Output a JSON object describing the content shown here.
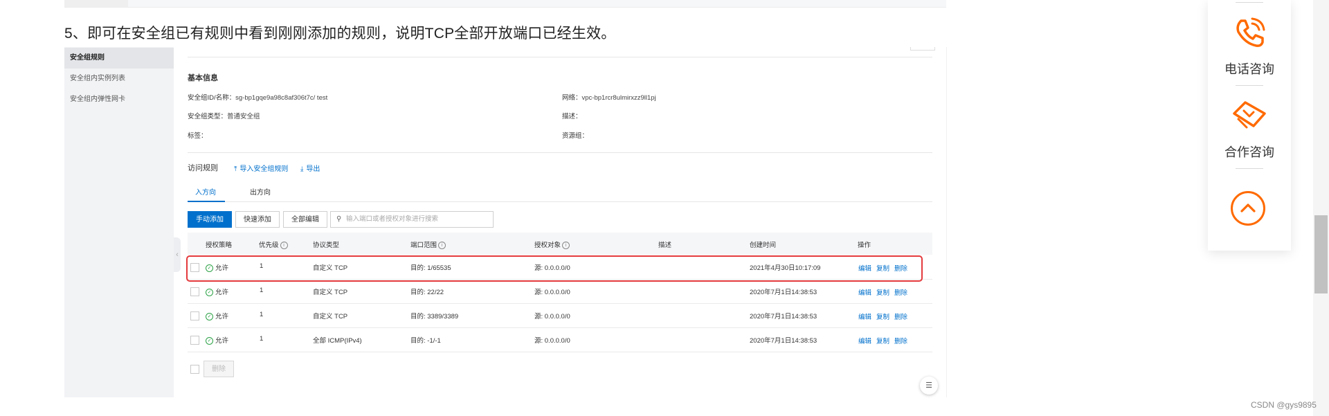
{
  "article": {
    "step_text": "5、即可在安全组已有规则中看到刚刚添加的规则，说明TCP全部开放端口已经生效。"
  },
  "sidebar": {
    "items": [
      {
        "label": "安全组规则",
        "active": true
      },
      {
        "label": "安全组内实例列表",
        "active": false
      },
      {
        "label": "安全组内弹性网卡",
        "active": false
      }
    ]
  },
  "basic_info": {
    "title": "基本信息",
    "fields": [
      {
        "key": "安全组ID/名称：",
        "value": "sg-bp1gqe9a98c8af306t7c/ test"
      },
      {
        "key": "网络：",
        "value": "vpc-bp1rcr8ulmirxzz9ll1pj"
      },
      {
        "key": "安全组类型：",
        "value": "普通安全组"
      },
      {
        "key": "描述：",
        "value": ""
      },
      {
        "key": "标签：",
        "value": ""
      },
      {
        "key": "资源组：",
        "value": ""
      }
    ]
  },
  "access_rules": {
    "title": "访问规则",
    "import_label": "导入安全组规则",
    "export_label": "导出"
  },
  "tabs": [
    {
      "label": "入方向",
      "active": true
    },
    {
      "label": "出方向",
      "active": false
    }
  ],
  "toolbar": {
    "manual_add": "手动添加",
    "quick_add": "快速添加",
    "edit_all": "全部编辑",
    "search_placeholder": "输入端口或者授权对象进行搜索"
  },
  "table": {
    "headers": [
      "授权策略",
      "优先级",
      "协议类型",
      "端口范围",
      "授权对象",
      "描述",
      "创建时间",
      "操作"
    ],
    "rows": [
      {
        "policy": "允许",
        "priority": "1",
        "protocol": "自定义 TCP",
        "port": "目的: 1/65535",
        "object": "源: 0.0.0.0/0",
        "desc": "",
        "created": "2021年4月30日10:17:09",
        "highlighted": true
      },
      {
        "policy": "允许",
        "priority": "1",
        "protocol": "自定义 TCP",
        "port": "目的: 22/22",
        "object": "源: 0.0.0.0/0",
        "desc": "",
        "created": "2020年7月1日14:38:53",
        "highlighted": false
      },
      {
        "policy": "允许",
        "priority": "1",
        "protocol": "自定义 TCP",
        "port": "目的: 3389/3389",
        "object": "源: 0.0.0.0/0",
        "desc": "",
        "created": "2020年7月1日14:38:53",
        "highlighted": false
      },
      {
        "policy": "允许",
        "priority": "1",
        "protocol": "全部 ICMP(IPv4)",
        "port": "目的: -1/-1",
        "object": "源: 0.0.0.0/0",
        "desc": "",
        "created": "2020年7月1日14:38:53",
        "highlighted": false
      }
    ],
    "actions": {
      "edit": "编辑",
      "copy": "复制",
      "delete": "删除"
    },
    "bulk_delete": "删除"
  },
  "float_panel": {
    "phone_label": "电话咨询",
    "cooperate_label": "合作咨询"
  },
  "watermark": "CSDN @gys9895",
  "colors": {
    "accent": "#0070cc",
    "highlight_border": "#e4393c",
    "float_accent": "#ff6a00",
    "allow_green": "#2ba245"
  }
}
